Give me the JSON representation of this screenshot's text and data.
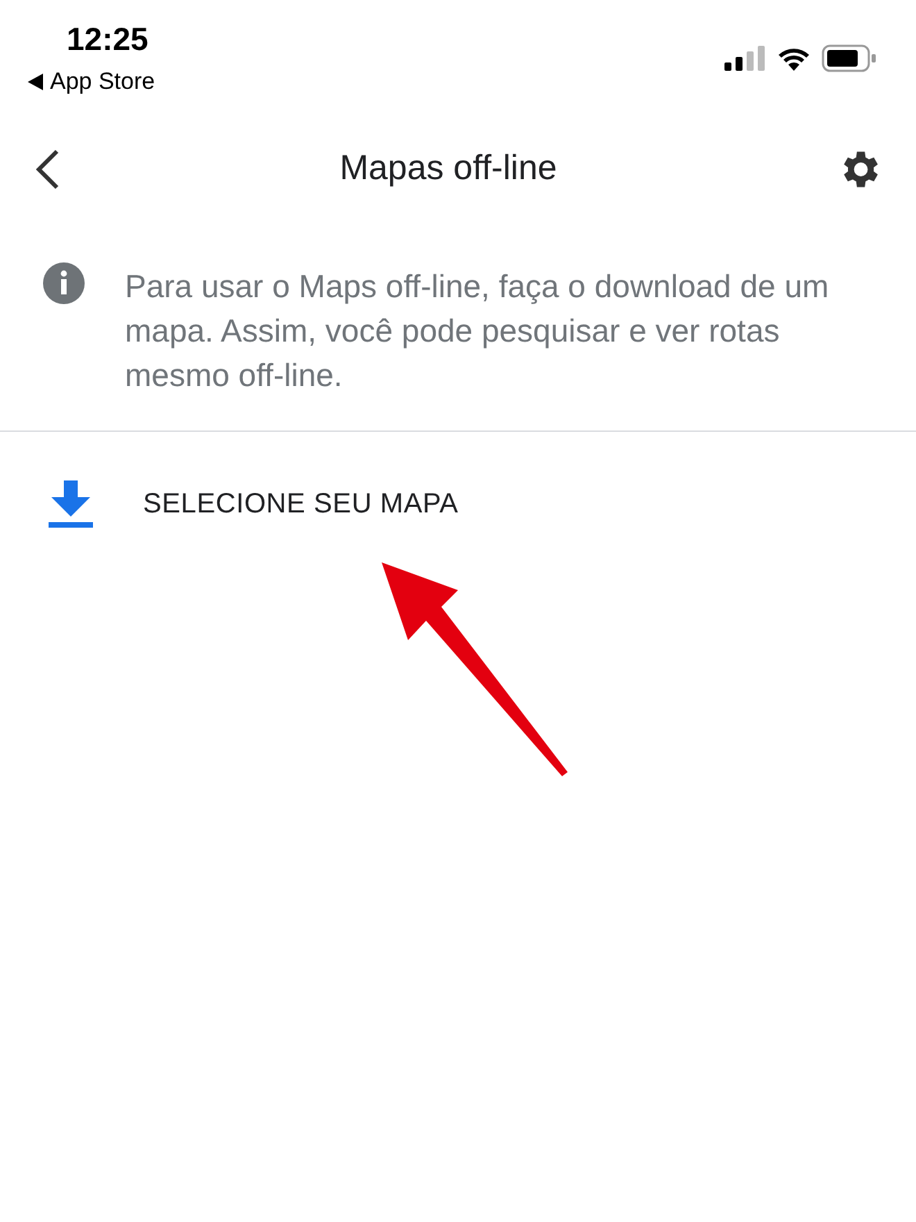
{
  "status_bar": {
    "time": "12:25",
    "back_app": "App Store"
  },
  "header": {
    "title": "Mapas off-line"
  },
  "info": {
    "text": "Para usar o Maps off-line, faça o download de um mapa. Assim, você pode pesquisar e ver rotas mesmo off-line."
  },
  "actions": [
    {
      "label": "SELECIONE SEU MAPA"
    }
  ]
}
